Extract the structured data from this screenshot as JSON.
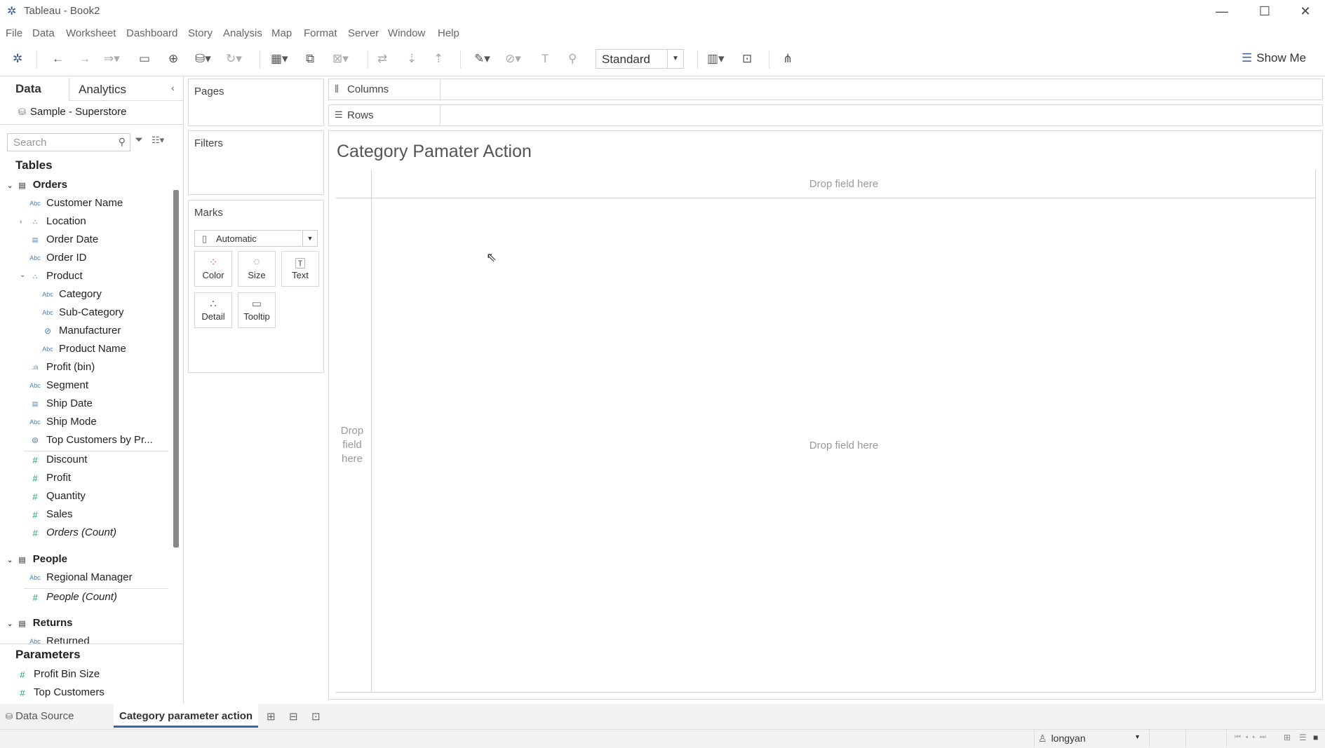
{
  "window": {
    "title": "Tableau - Book2",
    "logo_icon": "tableau-logo-icon",
    "minimize": "—",
    "maximize": "☐",
    "close": "✕"
  },
  "menu": [
    "File",
    "Data",
    "Worksheet",
    "Dashboard",
    "Story",
    "Analysis",
    "Map",
    "Format",
    "Server",
    "Window",
    "Help"
  ],
  "toolbar": {
    "fit_select": "Standard",
    "show_me": "Show Me"
  },
  "left_pane": {
    "tabs": {
      "data": "Data",
      "analytics": "Analytics"
    },
    "datasource": "Sample - Superstore",
    "search_placeholder": "Search",
    "tables_header": "Tables",
    "tables": [
      {
        "name": "Orders",
        "fields": [
          {
            "name": "Customer Name",
            "type": "Abc"
          },
          {
            "name": "Location",
            "type": "hier"
          },
          {
            "name": "Order Date",
            "type": "date"
          },
          {
            "name": "Order ID",
            "type": "Abc"
          },
          {
            "name": "Product",
            "type": "hier"
          },
          {
            "name": "Category",
            "type": "Abc"
          },
          {
            "name": "Sub-Category",
            "type": "Abc"
          },
          {
            "name": "Manufacturer",
            "type": "link"
          },
          {
            "name": "Product Name",
            "type": "Abc"
          },
          {
            "name": "Profit (bin)",
            "type": "bin"
          },
          {
            "name": "Segment",
            "type": "Abc"
          },
          {
            "name": "Ship Date",
            "type": "date"
          },
          {
            "name": "Ship Mode",
            "type": "Abc"
          },
          {
            "name": "Top Customers by Pr...",
            "type": "set"
          },
          {
            "name": "Discount",
            "type": "#"
          },
          {
            "name": "Profit",
            "type": "#"
          },
          {
            "name": "Quantity",
            "type": "#"
          },
          {
            "name": "Sales",
            "type": "#"
          },
          {
            "name": "Orders (Count)",
            "type": "#"
          }
        ]
      },
      {
        "name": "People",
        "fields": [
          {
            "name": "Regional Manager",
            "type": "Abc"
          },
          {
            "name": "People (Count)",
            "type": "#"
          }
        ]
      },
      {
        "name": "Returns",
        "fields": [
          {
            "name": "Returned",
            "type": "Abc"
          }
        ]
      }
    ],
    "parameters_header": "Parameters",
    "parameters": [
      "Profit Bin Size",
      "Top Customers"
    ]
  },
  "shelves": {
    "pages": "Pages",
    "filters": "Filters",
    "marks": "Marks",
    "columns": "Columns",
    "rows": "Rows"
  },
  "marks": {
    "type": "Automatic",
    "buttons": [
      "Color",
      "Size",
      "Text",
      "Detail",
      "Tooltip"
    ]
  },
  "view": {
    "title": "Category Pamater Action",
    "drop_top": "Drop field here",
    "drop_center": "Drop field here",
    "drop_left": "Drop field here"
  },
  "sheet_tabs": {
    "data_source": "Data Source",
    "active": "Category parameter action"
  },
  "status": {
    "user": "longyan"
  }
}
